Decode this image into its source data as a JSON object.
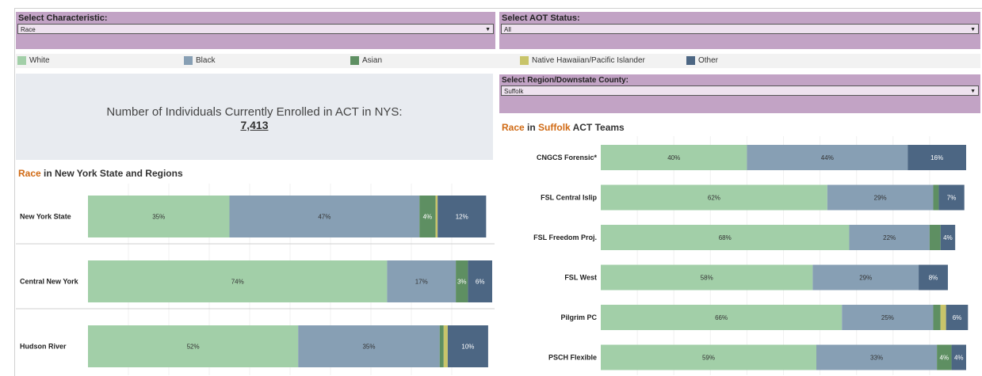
{
  "colors": {
    "White": "#a2cfa8",
    "Black": "#879fb4",
    "Asian": "#5e8f62",
    "Native Hawaiian/Pacific Islander": "#c8c46a",
    "Other": "#4c6683",
    "filter_bg": "#c2a3c5",
    "accent": "#d06a14"
  },
  "filters": {
    "characteristic": {
      "label": "Select Characteristic:",
      "value": "Race"
    },
    "aot_status": {
      "label": "Select AOT Status:",
      "value": "All"
    },
    "region": {
      "label": "Select Region/Downstate County:",
      "value": "Suffolk"
    }
  },
  "legend": [
    {
      "name": "White",
      "color": "#a2cfa8"
    },
    {
      "name": "Black",
      "color": "#879fb4"
    },
    {
      "name": "Asian",
      "color": "#5e8f62"
    },
    {
      "name": "Native Hawaiian/Pacific Islander",
      "color": "#c8c46a"
    },
    {
      "name": "Other",
      "color": "#4c6683"
    }
  ],
  "enrollment": {
    "label": "Number of Individuals Currently Enrolled in ACT in NYS:",
    "count": "7,413"
  },
  "left_title": {
    "highlight": "Race",
    "rest": " in New York State and Regions"
  },
  "right_title": {
    "highlight1": "Race",
    "mid": " in ",
    "highlight2": "Suffolk",
    "rest": " ACT Teams"
  },
  "chart_data": [
    {
      "type": "bar",
      "orientation": "horizontal",
      "stacked": true,
      "categories": [
        "New York State",
        "Central New York",
        "Hudson River"
      ],
      "series": [
        {
          "name": "White",
          "values": [
            35,
            74,
            52
          ],
          "labels": [
            "35%",
            "74%",
            "52%"
          ]
        },
        {
          "name": "Black",
          "values": [
            47,
            17,
            35
          ],
          "labels": [
            "47%",
            "17%",
            "35%"
          ]
        },
        {
          "name": "Asian",
          "values": [
            4,
            3,
            1
          ],
          "labels": [
            "4%",
            "3%",
            ""
          ]
        },
        {
          "name": "Native Hawaiian/Pacific Islander",
          "values": [
            0.5,
            0,
            1
          ],
          "labels": [
            "",
            "",
            ""
          ]
        },
        {
          "name": "Other",
          "values": [
            12,
            6,
            10
          ],
          "labels": [
            "12%",
            "6%",
            "10%"
          ]
        }
      ]
    },
    {
      "type": "bar",
      "orientation": "horizontal",
      "stacked": true,
      "categories": [
        "CNGCS Forensic*",
        "FSL Central Islip",
        "FSL Freedom Proj.",
        "FSL West",
        "Pilgrim PC",
        "PSCH Flexible"
      ],
      "series": [
        {
          "name": "White",
          "values": [
            40,
            62,
            68,
            58,
            66,
            59
          ],
          "labels": [
            "40%",
            "62%",
            "68%",
            "58%",
            "66%",
            "59%"
          ]
        },
        {
          "name": "Black",
          "values": [
            44,
            29,
            22,
            29,
            25,
            33
          ],
          "labels": [
            "44%",
            "29%",
            "22%",
            "29%",
            "25%",
            "33%"
          ]
        },
        {
          "name": "Asian",
          "values": [
            0,
            1.5,
            3,
            0,
            2,
            4
          ],
          "labels": [
            "",
            "",
            "",
            "",
            "",
            "4%"
          ]
        },
        {
          "name": "Native Hawaiian/Pacific Islander",
          "values": [
            0,
            0,
            0,
            0,
            1.5,
            0
          ],
          "labels": [
            "",
            "",
            "",
            "",
            "",
            ""
          ]
        },
        {
          "name": "Other",
          "values": [
            16,
            7,
            4,
            8,
            6,
            4
          ],
          "labels": [
            "16%",
            "7%",
            "4%",
            "8%",
            "6%",
            "4%"
          ]
        }
      ]
    }
  ]
}
